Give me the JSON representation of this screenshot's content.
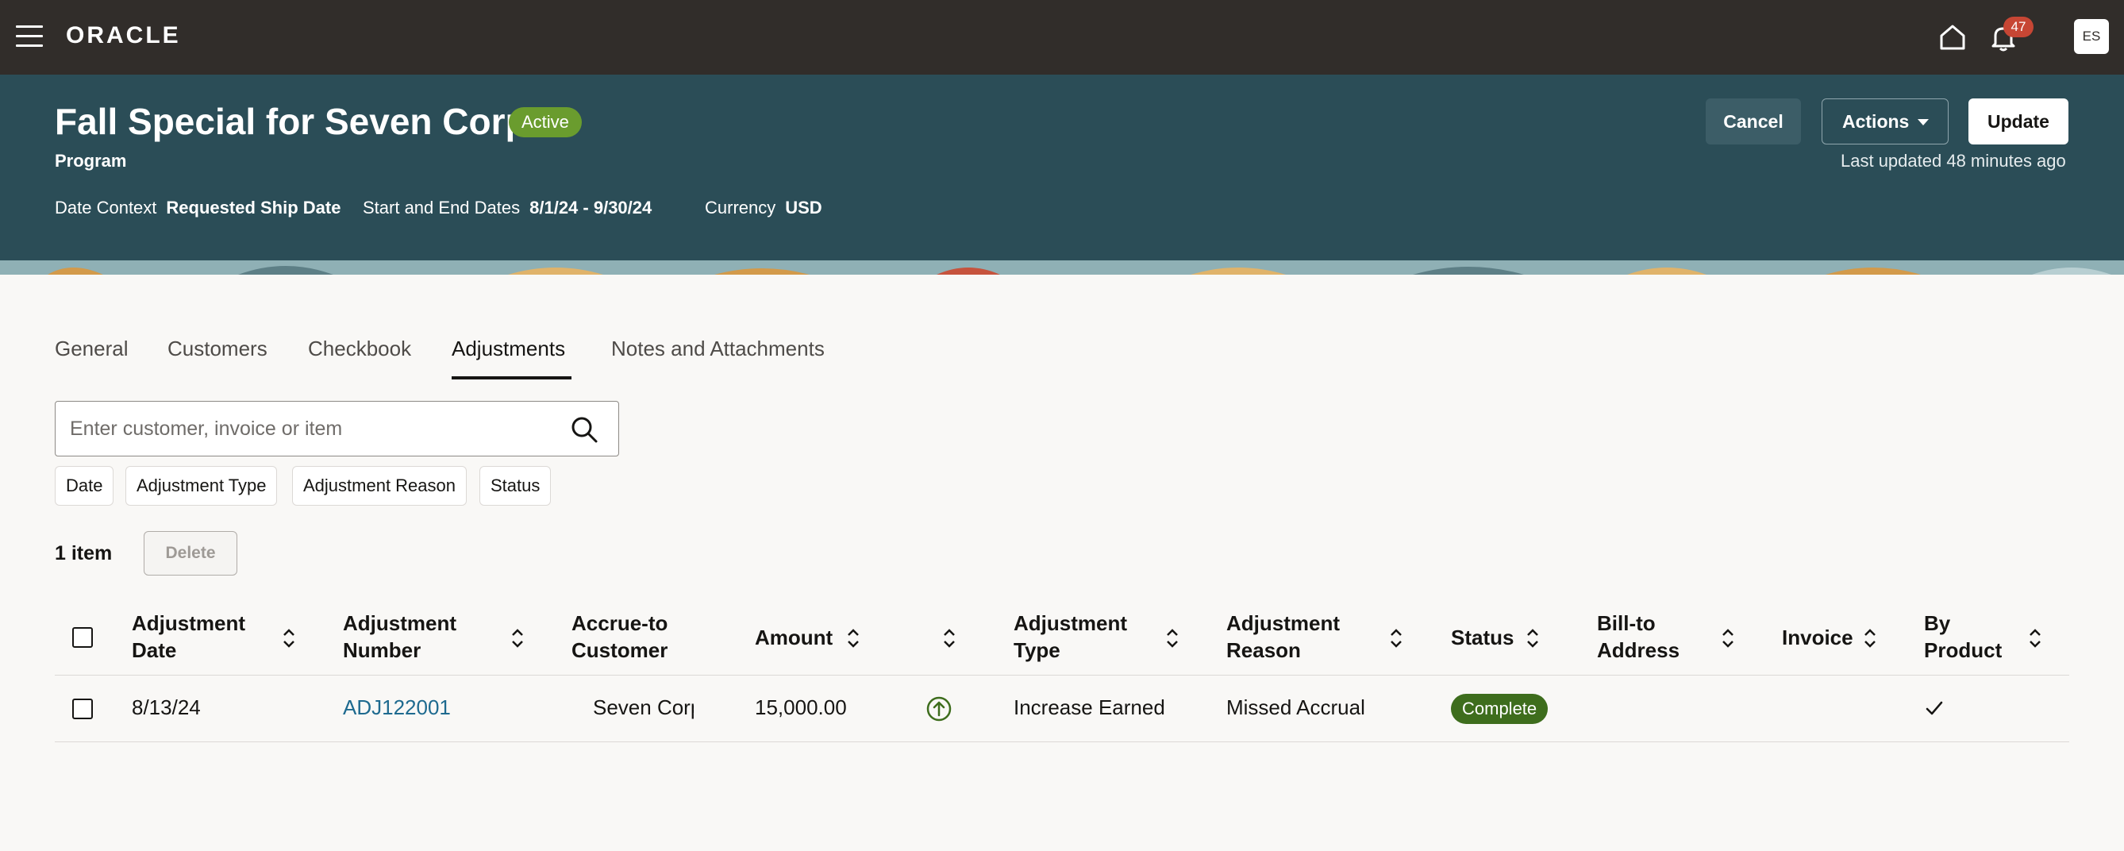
{
  "app": {
    "logo": "ORACLE",
    "notifications_count": "47",
    "user_initials": "ES"
  },
  "header": {
    "title": "Fall Special for Seven Corp",
    "status": "Active",
    "subtitle": "Program",
    "meta": [
      {
        "label": "Date Context",
        "value": "Requested Ship Date"
      },
      {
        "label": "Start and End Dates",
        "value": "8/1/24 - 9/30/24"
      },
      {
        "label": "Currency",
        "value": "USD"
      }
    ],
    "buttons": {
      "cancel": "Cancel",
      "actions": "Actions",
      "update": "Update"
    },
    "last_updated": "Last updated 48 minutes ago"
  },
  "tabs": [
    {
      "label": "General",
      "active": false
    },
    {
      "label": "Customers",
      "active": false
    },
    {
      "label": "Checkbook",
      "active": false
    },
    {
      "label": "Adjustments",
      "active": true
    },
    {
      "label": "Notes and Attachments",
      "active": false
    }
  ],
  "search": {
    "placeholder": "Enter customer, invoice or item",
    "value": ""
  },
  "filters": [
    "Date",
    "Adjustment Type",
    "Adjustment Reason",
    "Status"
  ],
  "list": {
    "count": "1 item",
    "delete_label": "Delete"
  },
  "table": {
    "columns": [
      {
        "line1": "Adjustment",
        "line2": "Date"
      },
      {
        "line1": "Adjustment",
        "line2": "Number"
      },
      {
        "line1": "Accrue-to",
        "line2": "Customer"
      },
      {
        "line1": "Amount",
        "line2": ""
      },
      {
        "line1": "",
        "line2": ""
      },
      {
        "line1": "Adjustment",
        "line2": "Type"
      },
      {
        "line1": "Adjustment",
        "line2": "Reason"
      },
      {
        "line1": "Status",
        "line2": ""
      },
      {
        "line1": "Bill-to",
        "line2": "Address"
      },
      {
        "line1": "Invoice",
        "line2": ""
      },
      {
        "line1": "By",
        "line2": "Product"
      }
    ],
    "rows": [
      {
        "date": "8/13/24",
        "number": "ADJ122001",
        "customer": "Seven Corp",
        "amount": "15,000.00",
        "direction_icon": "arrow-up-circle-icon",
        "type": "Increase Earned",
        "reason": "Missed Accrual",
        "status": "Complete",
        "bill_to": "",
        "invoice": "",
        "by_product": "checkmark-icon"
      }
    ]
  },
  "colors": {
    "topbar": "#312d2a",
    "header": "#2b4d57",
    "active_badge": "#6a9c2e",
    "complete_badge": "#3e6d1d",
    "link": "#1e6a8f",
    "notification_badge": "#c74634"
  }
}
